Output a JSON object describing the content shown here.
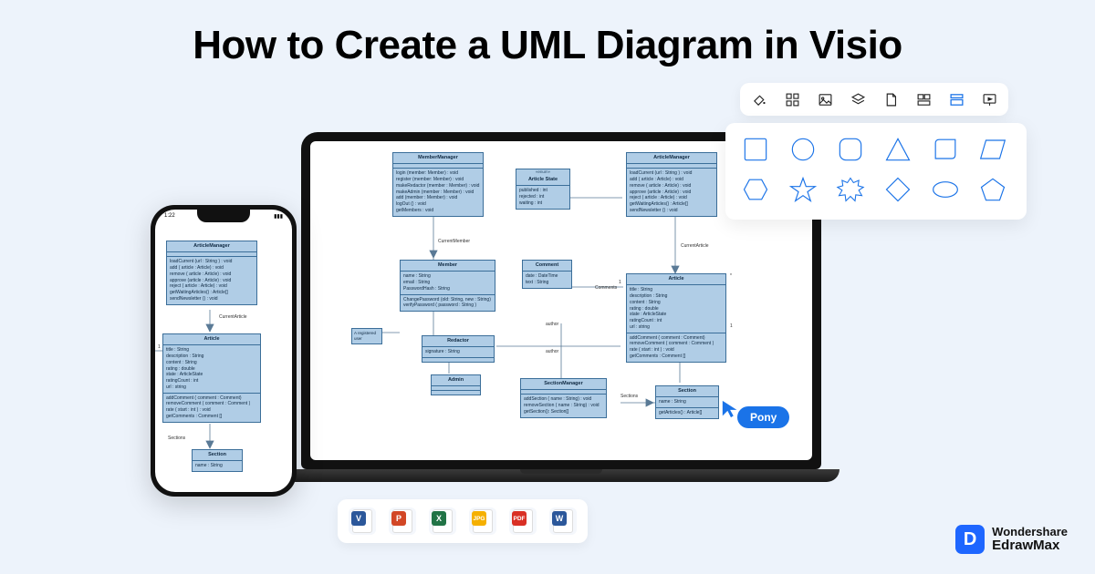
{
  "title": "How to Create a UML Diagram in Visio",
  "collaborator": "Pony",
  "brand": {
    "line1": "Wondershare",
    "line2": "EdrawMax",
    "glyph": "D"
  },
  "toolbar_icons": [
    "fill-bucket",
    "grid-app",
    "image-insert",
    "layers",
    "page",
    "align",
    "template",
    "present"
  ],
  "shapes_row1": [
    "square",
    "circle",
    "rounded-square",
    "triangle",
    "leaf",
    "parallelogram"
  ],
  "shapes_row2": [
    "hexagon",
    "star",
    "burst",
    "diamond",
    "ellipse",
    "pentagon"
  ],
  "export": [
    {
      "label": "V",
      "color": "#2b579a"
    },
    {
      "label": "P",
      "color": "#d24726"
    },
    {
      "label": "X",
      "color": "#217346"
    },
    {
      "label": "JPG",
      "color": "#f5b000"
    },
    {
      "label": "PDF",
      "color": "#d93025"
    },
    {
      "label": "W",
      "color": "#2b579a"
    }
  ],
  "uml": {
    "MemberManager": {
      "title": "MemberManager",
      "ops": [
        "login (member: Member) : void",
        "register (member: Member) : void",
        "makeRedactor (member : Member) : void",
        "makeAdmin (member : Member) : void",
        "add (member : Member) : void",
        "logOut () : void",
        "getMembers : void"
      ]
    },
    "ArticleManager": {
      "title": "ArticleManager",
      "ops": [
        "loadCurrent (url : String ) : void",
        "add ( article : Article) : void",
        "remove ( article : Article) : void",
        "approve (article : Article) : void",
        "reject ( article : Article) : void",
        "getWaitingArticles() : Article[]",
        "sendNewsletter () : void"
      ]
    },
    "ArticleState": {
      "title": "Article State",
      "attrs": [
        "published : int",
        "rejected : int",
        "waiting : int"
      ]
    },
    "Member": {
      "title": "Member",
      "attrs": [
        "name : String",
        "email : String",
        "PasswordHash : String"
      ],
      "ops": [
        "ChangePassword (old: String, new : String)",
        "verifyPassword ( password : String )"
      ]
    },
    "Comment": {
      "title": "Comment",
      "attrs": [
        "date : DateTime",
        "text : String"
      ]
    },
    "Article": {
      "title": "Article",
      "attrs": [
        "title : String",
        "description : String",
        "content : String",
        "rating : double",
        "state : ArticleState",
        "ratingCount : int",
        "url : string"
      ],
      "ops": [
        "addComment ( comment : Comment)",
        "removeComment ( comment : Comment )",
        "rate ( start : int ) : void",
        "getComments : Comment []"
      ]
    },
    "Redactor": {
      "title": "Redactor",
      "attrs": [
        "signature : String"
      ]
    },
    "Admin": {
      "title": "Admin"
    },
    "SectionManager": {
      "title": "SectionManager",
      "ops": [
        "addSection ( name : String) : void",
        "removeSection ( name : String) : void",
        "getSection(): Section[]"
      ]
    },
    "Section": {
      "title": "Section",
      "attrs": [
        "name : String"
      ],
      "ops": [
        "getArticles() : Article[]"
      ]
    },
    "Note": {
      "text": "A registered\nuser"
    },
    "labels": {
      "CurrentMember": "CurrentMember",
      "CurrentArticle": "CurrentArticle",
      "author": "author",
      "Comments": "Comments",
      "Sections": "Sections"
    }
  },
  "phone_status": {
    "left": "1:22",
    "right": "▮▮▮"
  }
}
